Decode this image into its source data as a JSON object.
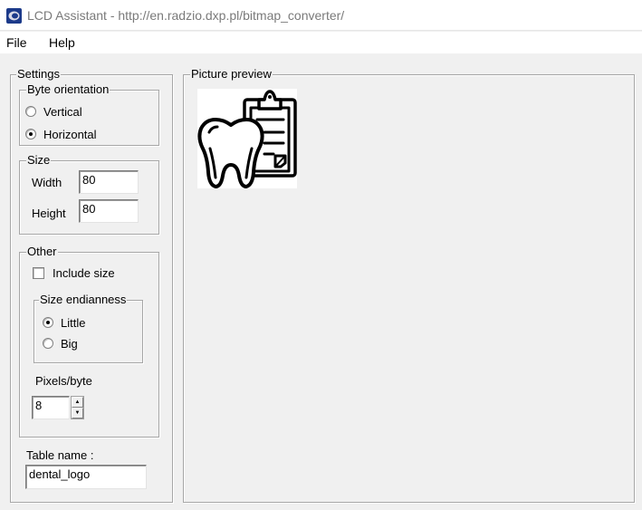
{
  "window": {
    "title": "LCD Assistant -  http://en.radzio.dxp.pl/bitmap_converter/",
    "app_icon": "lcd-assistant-icon"
  },
  "menu": {
    "items": [
      "File",
      "Help"
    ]
  },
  "settings": {
    "legend": "Settings",
    "byte_orientation": {
      "legend": "Byte orientation",
      "options": [
        "Vertical",
        "Horizontal"
      ],
      "selected": "Horizontal"
    },
    "size": {
      "legend": "Size",
      "width_label": "Width",
      "width_value": "80",
      "height_label": "Height",
      "height_value": "80"
    },
    "other": {
      "legend": "Other",
      "include_size_label": "Include size",
      "include_size_checked": false,
      "endianness": {
        "legend": "Size endianness",
        "options": [
          "Little",
          "Big"
        ],
        "selected": "Little"
      },
      "pixels_per_byte_label": "Pixels/byte",
      "pixels_per_byte_value": "8"
    },
    "table_name_label": "Table name :",
    "table_name_value": "dental_logo"
  },
  "preview": {
    "legend": "Picture preview",
    "image_icon": "tooth-clipboard-icon"
  },
  "colors": {
    "frame_border": "#a6a6a6",
    "window_bg": "#f0f0f0",
    "title_text": "#7a7a7a"
  }
}
